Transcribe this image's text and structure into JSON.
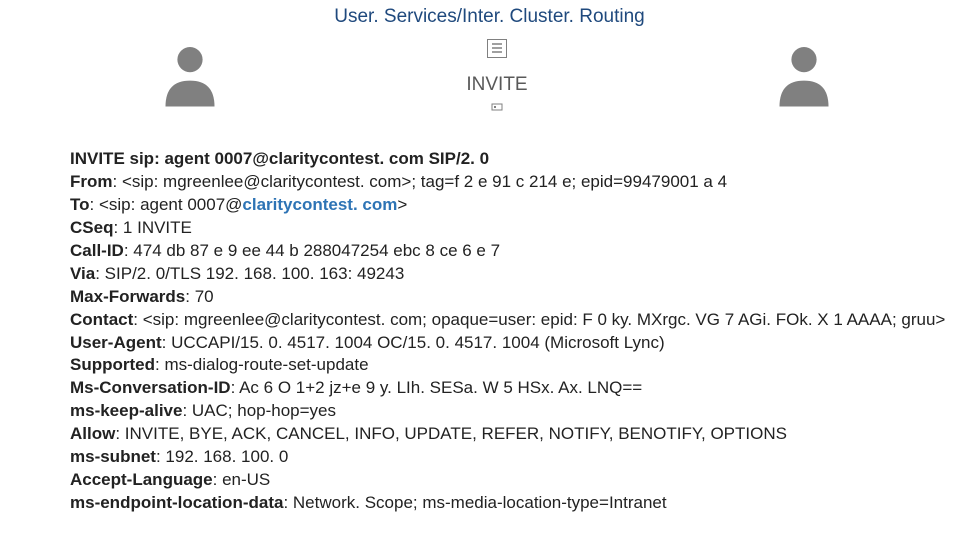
{
  "title": "User. Services/Inter. Cluster. Routing",
  "diagram": {
    "invite_label": "INVITE"
  },
  "sip": {
    "request_line": "INVITE sip: agent 0007@claritycontest. com SIP/2. 0",
    "from": {
      "name": "From",
      "value": ": <sip: mgreenlee@claritycontest. com>; tag=f 2 e 91 c 214 e; epid=99479001 a 4"
    },
    "to": {
      "name": "To",
      "prefix": ": <sip: agent 0007@",
      "highlight": "claritycontest. com",
      "suffix": ">"
    },
    "cseq": {
      "name": "CSeq",
      "value": ": 1 INVITE"
    },
    "call_id": {
      "name": "Call-ID",
      "value": ": 474 db 87 e 9 ee 44 b 288047254 ebc 8 ce 6 e 7"
    },
    "via": {
      "name": "Via",
      "value": ": SIP/2. 0/TLS 192. 168. 100. 163: 49243"
    },
    "max_forwards": {
      "name": "Max-Forwards",
      "value": ": 70"
    },
    "contact": {
      "name": "Contact",
      "value": ": <sip: mgreenlee@claritycontest. com; opaque=user: epid: F 0 ky. MXrgc. VG 7 AGi. FOk. X 1 AAAA; gruu>"
    },
    "user_agent": {
      "name": "User-Agent",
      "value": ": UCCAPI/15. 0. 4517. 1004 OC/15. 0. 4517. 1004 (Microsoft Lync)"
    },
    "supported": {
      "name": "Supported",
      "value": ": ms-dialog-route-set-update"
    },
    "ms_conversation_id": {
      "name": "Ms-Conversation-ID",
      "value": ": Ac 6 O 1+2 jz+e 9 y. LIh. SESa. W 5 HSx. Ax. LNQ=="
    },
    "ms_keep_alive": {
      "name": "ms-keep-alive",
      "value": ": UAC; hop-hop=yes"
    },
    "allow": {
      "name": "Allow",
      "value": ": INVITE, BYE, ACK, CANCEL, INFO, UPDATE, REFER, NOTIFY, BENOTIFY, OPTIONS"
    },
    "ms_subnet": {
      "name": "ms-subnet",
      "value": ": 192. 168. 100. 0"
    },
    "accept_language": {
      "name": "Accept-Language",
      "value": ": en-US"
    },
    "ms_endpoint_location_data": {
      "name": "ms-endpoint-location-data",
      "value": ": Network. Scope; ms-media-location-type=Intranet"
    }
  }
}
